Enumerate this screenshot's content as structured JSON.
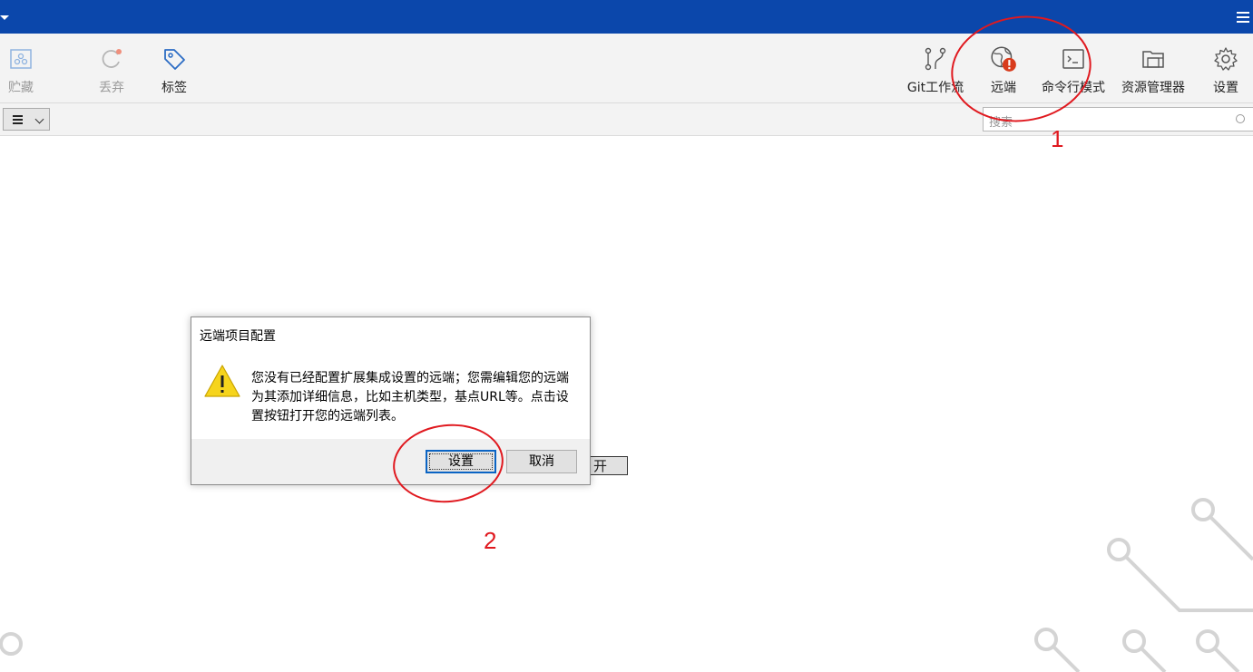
{
  "toolbar": {
    "left": [
      {
        "label": "贮藏",
        "icon": "stash-icon",
        "enabled": false
      },
      {
        "label": "丢弃",
        "icon": "discard-icon",
        "enabled": false
      },
      {
        "label": "标签",
        "icon": "tag-icon",
        "enabled": true
      }
    ],
    "right": [
      {
        "label": "Git工作流",
        "icon": "git-flow-icon"
      },
      {
        "label": "远端",
        "icon": "globe-warning-icon"
      },
      {
        "label": "命令行模式",
        "icon": "terminal-icon"
      },
      {
        "label": "资源管理器",
        "icon": "folder-icon"
      },
      {
        "label": "设置",
        "icon": "gear-icon"
      }
    ]
  },
  "subbar": {
    "search_placeholder": "搜索"
  },
  "behind_button": {
    "label": "开"
  },
  "dialog": {
    "title": "远端项目配置",
    "message": "您没有已经配置扩展集成设置的远端；您需编辑您的远端为其添加详细信息，比如主机类型，基点URL等。点击设置按钮打开您的远端列表。",
    "primary_label": "设置",
    "cancel_label": "取消"
  },
  "annotations": {
    "label_1": "1",
    "label_2": "2",
    "color": "#e0191f"
  },
  "colors": {
    "titlebar": "#0b47ab",
    "accent": "#1a5fb4"
  }
}
